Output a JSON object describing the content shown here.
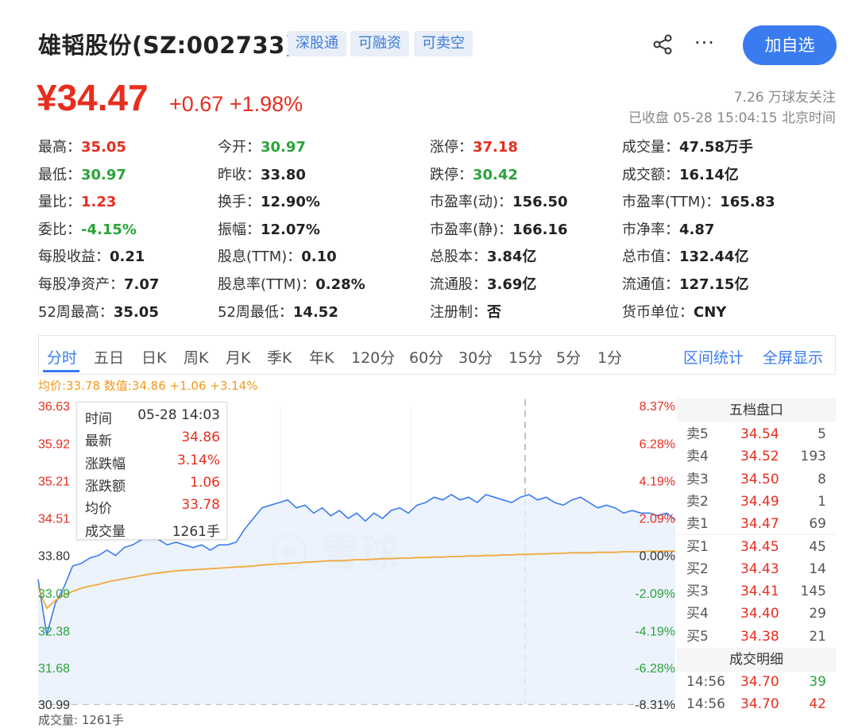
{
  "header": {
    "title": "雄韬股份(SZ:002733)",
    "tags": [
      "深股通",
      "可融资",
      "可卖空"
    ],
    "share_icon": "share-icon",
    "more_icon": "more-icon",
    "more_text": "···",
    "add_button": "加自选",
    "price": "¥34.47",
    "change": "+0.67 +1.98%",
    "followers": "7.26 万球友关注",
    "status": "已收盘 05-28 15:04:15 北京时间"
  },
  "stats": [
    {
      "label": "最高：",
      "value": "35.05",
      "color": "red"
    },
    {
      "label": "今开：",
      "value": "30.97",
      "color": "green"
    },
    {
      "label": "涨停：",
      "value": "37.18",
      "color": "red"
    },
    {
      "label": "成交量：",
      "value": "47.58万手",
      "color": "dark"
    },
    {
      "label": "最低：",
      "value": "30.97",
      "color": "green"
    },
    {
      "label": "昨收：",
      "value": "33.80",
      "color": "dark"
    },
    {
      "label": "跌停：",
      "value": "30.42",
      "color": "green"
    },
    {
      "label": "成交额：",
      "value": "16.14亿",
      "color": "dark"
    },
    {
      "label": "量比：",
      "value": "1.23",
      "color": "red"
    },
    {
      "label": "换手：",
      "value": "12.90%",
      "color": "dark"
    },
    {
      "label": "市盈率(动)：",
      "value": "156.50",
      "color": "dark"
    },
    {
      "label": "市盈率(TTM)：",
      "value": "165.83",
      "color": "dark"
    },
    {
      "label": "委比：",
      "value": "-4.15%",
      "color": "green"
    },
    {
      "label": "振幅：",
      "value": "12.07%",
      "color": "dark"
    },
    {
      "label": "市盈率(静)：",
      "value": "166.16",
      "color": "dark"
    },
    {
      "label": "市净率：",
      "value": "4.87",
      "color": "dark"
    },
    {
      "label": "每股收益：",
      "value": "0.21",
      "color": "dark"
    },
    {
      "label": "股息(TTM)：",
      "value": "0.10",
      "color": "dark"
    },
    {
      "label": "总股本：",
      "value": "3.84亿",
      "color": "dark"
    },
    {
      "label": "总市值：",
      "value": "132.44亿",
      "color": "dark"
    },
    {
      "label": "每股净资产：",
      "value": "7.07",
      "color": "dark"
    },
    {
      "label": "股息率(TTM)：",
      "value": "0.28%",
      "color": "dark"
    },
    {
      "label": "流通股：",
      "value": "3.69亿",
      "color": "dark"
    },
    {
      "label": "流通值：",
      "value": "127.15亿",
      "color": "dark"
    },
    {
      "label": "52周最高：",
      "value": "35.05",
      "color": "dark"
    },
    {
      "label": "52周最低：",
      "value": "14.52",
      "color": "dark"
    },
    {
      "label": "注册制：",
      "value": "否",
      "color": "dark"
    },
    {
      "label": "货币单位：",
      "value": "CNY",
      "color": "dark"
    }
  ],
  "tabs": [
    "分时",
    "五日",
    "日K",
    "周K",
    "月K",
    "季K",
    "年K",
    "120分",
    "60分",
    "30分",
    "15分",
    "5分",
    "1分"
  ],
  "active_tab": "分时",
  "tab_links": [
    "区间统计",
    "全屏显示"
  ],
  "hover_summary": "均价:33.78 数值:34.86 +1.06 +3.14%",
  "tooltip": {
    "rows": [
      {
        "label": "时间",
        "value": "05-28 14:03"
      },
      {
        "label": "最新",
        "value": "34.86"
      },
      {
        "label": "涨跌幅",
        "value": "3.14%"
      },
      {
        "label": "涨跌额",
        "value": "1.06"
      },
      {
        "label": "均价",
        "value": "33.78"
      },
      {
        "label": "成交量",
        "value": "1261手"
      }
    ]
  },
  "watermark": "雪球",
  "volume_caption": "成交量: 1261手",
  "order_book": {
    "title": "五档盘口",
    "rows": [
      {
        "label": "卖5",
        "price": "34.54",
        "vol": "5"
      },
      {
        "label": "卖4",
        "price": "34.52",
        "vol": "193"
      },
      {
        "label": "卖3",
        "price": "34.50",
        "vol": "8"
      },
      {
        "label": "卖2",
        "price": "34.49",
        "vol": "1"
      },
      {
        "label": "卖1",
        "price": "34.47",
        "vol": "69"
      },
      {
        "label": "买1",
        "price": "34.45",
        "vol": "45"
      },
      {
        "label": "买2",
        "price": "34.43",
        "vol": "14"
      },
      {
        "label": "买3",
        "price": "34.41",
        "vol": "145"
      },
      {
        "label": "买4",
        "price": "34.40",
        "vol": "29"
      },
      {
        "label": "买5",
        "price": "34.38",
        "vol": "21"
      }
    ],
    "detail_title": "成交明细",
    "details": [
      {
        "time": "14:56",
        "price": "34.70",
        "vol": "39",
        "dir": "green"
      },
      {
        "time": "14:56",
        "price": "34.70",
        "vol": "42",
        "dir": "red"
      }
    ]
  },
  "colors": {
    "up": "#e62e1f",
    "down": "#2aa33a",
    "accent": "#3a7bf0",
    "avg_line": "#f0a93c",
    "price_line": "#3a7bf0"
  },
  "chart_data": {
    "type": "line",
    "title": "",
    "ylim": [
      30.99,
      36.63
    ],
    "y_ticks_left": [
      "36.63",
      "35.92",
      "35.21",
      "34.51",
      "33.80",
      "33.09",
      "32.38",
      "31.68",
      "30.99"
    ],
    "y_ticks_right": [
      "8.37%",
      "6.28%",
      "4.19%",
      "2.09%",
      "0.00%",
      "-2.09%",
      "-4.19%",
      "-6.28%",
      "-8.31%"
    ],
    "series": [
      {
        "values": [
          33.35,
          32.3,
          32.9,
          33.2,
          33.6,
          33.65,
          33.75,
          33.8,
          33.9,
          33.8,
          33.95,
          34.0,
          34.1,
          34.15,
          34.1,
          34.0,
          34.05,
          34.0,
          33.95,
          34.0,
          33.9,
          34.0,
          34.0,
          34.05,
          34.3,
          34.5,
          34.7,
          34.75,
          34.8,
          34.85,
          34.7,
          34.75,
          34.6,
          34.7,
          34.55,
          34.65,
          34.5,
          34.6,
          34.45,
          34.6,
          34.5,
          34.65,
          34.7,
          34.6,
          34.75,
          34.8,
          34.9,
          34.85,
          34.95,
          34.85,
          34.9,
          34.8,
          34.95,
          34.9,
          34.85,
          34.8,
          34.9,
          34.95,
          34.85,
          34.9,
          34.8,
          34.75,
          34.85,
          34.9,
          34.8,
          34.7,
          34.75,
          34.7,
          34.6,
          34.65,
          34.6,
          34.6,
          34.55,
          34.6,
          34.47
        ]
      },
      {
        "values": [
          33.2,
          32.8,
          32.95,
          33.05,
          33.12,
          33.18,
          33.22,
          33.25,
          33.3,
          33.33,
          33.36,
          33.39,
          33.42,
          33.45,
          33.47,
          33.49,
          33.51,
          33.52,
          33.53,
          33.54,
          33.55,
          33.56,
          33.57,
          33.58,
          33.59,
          33.6,
          33.62,
          33.63,
          33.64,
          33.65,
          33.66,
          33.67,
          33.68,
          33.69,
          33.7,
          33.7,
          33.71,
          33.72,
          33.72,
          33.73,
          33.74,
          33.74,
          33.75,
          33.75,
          33.76,
          33.76,
          33.77,
          33.77,
          33.78,
          33.78,
          33.79,
          33.79,
          33.8,
          33.8,
          33.81,
          33.81,
          33.82,
          33.82,
          33.83,
          33.83,
          33.84,
          33.84,
          33.85,
          33.85,
          33.85,
          33.86,
          33.86,
          33.86,
          33.87,
          33.87,
          33.87,
          33.88,
          33.88,
          33.88,
          33.88
        ]
      }
    ]
  }
}
